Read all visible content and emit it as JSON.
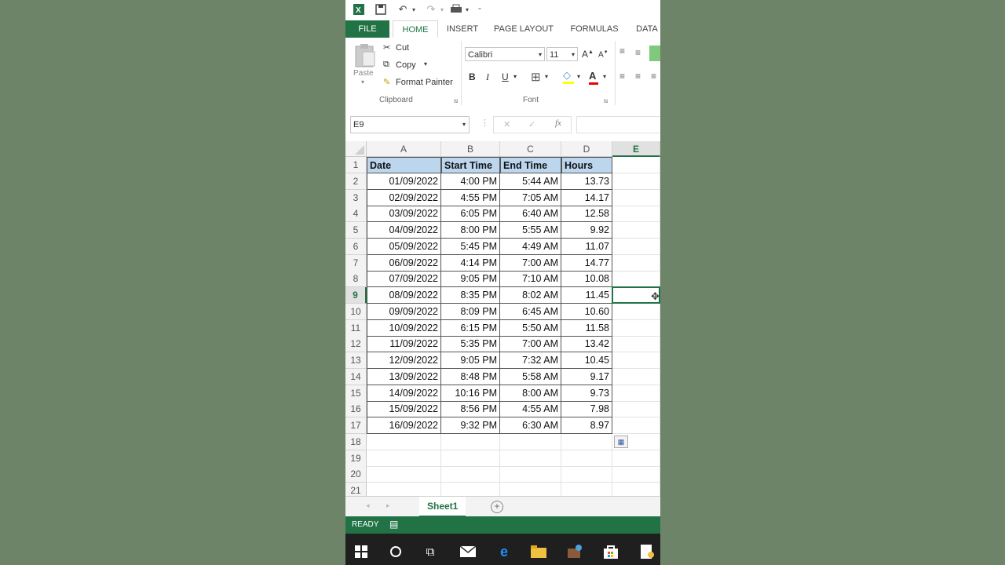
{
  "ribbon": {
    "tabs": [
      "FILE",
      "HOME",
      "INSERT",
      "PAGE LAYOUT",
      "FORMULAS",
      "DATA"
    ],
    "clipboard": {
      "paste": "Paste",
      "cut": "Cut",
      "copy": "Copy",
      "format_painter": "Format Painter",
      "group": "Clipboard"
    },
    "font": {
      "name": "Calibri",
      "size": "11",
      "bold": "B",
      "italic": "I",
      "underline": "U",
      "group": "Font"
    }
  },
  "formula_bar": {
    "name_box": "E9",
    "value": ""
  },
  "grid": {
    "columns": [
      "A",
      "B",
      "C",
      "D",
      "E"
    ],
    "rows": [
      "1",
      "2",
      "3",
      "4",
      "5",
      "6",
      "7",
      "8",
      "9",
      "10",
      "11",
      "12",
      "13",
      "14",
      "15",
      "16",
      "17",
      "18",
      "19",
      "20",
      "21"
    ],
    "headers": [
      "Date",
      "Start Time",
      "End Time",
      "Hours"
    ],
    "data": [
      [
        "01/09/2022",
        "4:00 PM",
        "5:44 AM",
        "13.73"
      ],
      [
        "02/09/2022",
        "4:55 PM",
        "7:05 AM",
        "14.17"
      ],
      [
        "03/09/2022",
        "6:05 PM",
        "6:40 AM",
        "12.58"
      ],
      [
        "04/09/2022",
        "8:00 PM",
        "5:55 AM",
        "9.92"
      ],
      [
        "05/09/2022",
        "5:45 PM",
        "4:49 AM",
        "11.07"
      ],
      [
        "06/09/2022",
        "4:14 PM",
        "7:00 AM",
        "14.77"
      ],
      [
        "07/09/2022",
        "9:05 PM",
        "7:10 AM",
        "10.08"
      ],
      [
        "08/09/2022",
        "8:35 PM",
        "8:02 AM",
        "11.45"
      ],
      [
        "09/09/2022",
        "8:09 PM",
        "6:45 AM",
        "10.60"
      ],
      [
        "10/09/2022",
        "6:15 PM",
        "5:50 AM",
        "11.58"
      ],
      [
        "11/09/2022",
        "5:35 PM",
        "7:00 AM",
        "13.42"
      ],
      [
        "12/09/2022",
        "9:05 PM",
        "7:32 AM",
        "10.45"
      ],
      [
        "13/09/2022",
        "8:48 PM",
        "5:58 AM",
        "9.17"
      ],
      [
        "14/09/2022",
        "10:16 PM",
        "8:00 AM",
        "9.73"
      ],
      [
        "15/09/2022",
        "8:56 PM",
        "4:55 AM",
        "7.98"
      ],
      [
        "16/09/2022",
        "9:32 PM",
        "6:30 AM",
        "8.97"
      ]
    ]
  },
  "sheets": [
    "Sheet1"
  ],
  "status": "READY",
  "colors": {
    "excel_green": "#217346",
    "header_fill": "#bcd6ee",
    "background": "#6e8468"
  }
}
